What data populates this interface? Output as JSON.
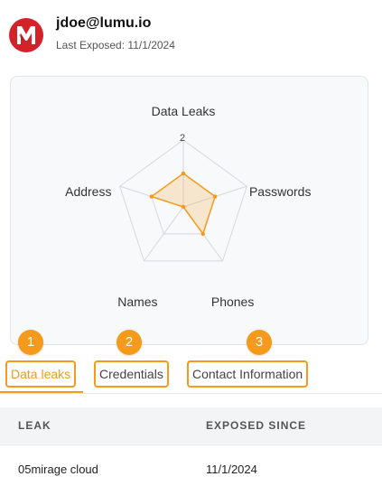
{
  "profile": {
    "email": "jdoe@lumu.io",
    "last_exposed_label": "Last Exposed:",
    "last_exposed_value": "11/1/2024",
    "logo_icon": "m-logo-icon",
    "logo_color": "#d2232a"
  },
  "chart_data": {
    "type": "radar",
    "axes": [
      "Data Leaks",
      "Passwords",
      "Phones",
      "Names",
      "Address"
    ],
    "values": [
      1,
      1,
      1,
      0,
      1
    ],
    "max": 2,
    "tick_label": "2",
    "color": "#f59a1c"
  },
  "tabs": [
    {
      "label": "Data leaks",
      "badge": "1",
      "active": true
    },
    {
      "label": "Credentials",
      "badge": "2",
      "active": false
    },
    {
      "label": "Contact Information",
      "badge": "3",
      "active": false
    }
  ],
  "table": {
    "columns": [
      "LEAK",
      "EXPOSED SINCE"
    ],
    "rows": [
      [
        "05mirage cloud",
        "11/1/2024"
      ]
    ]
  },
  "colors": {
    "accent": "#f59a1c"
  }
}
